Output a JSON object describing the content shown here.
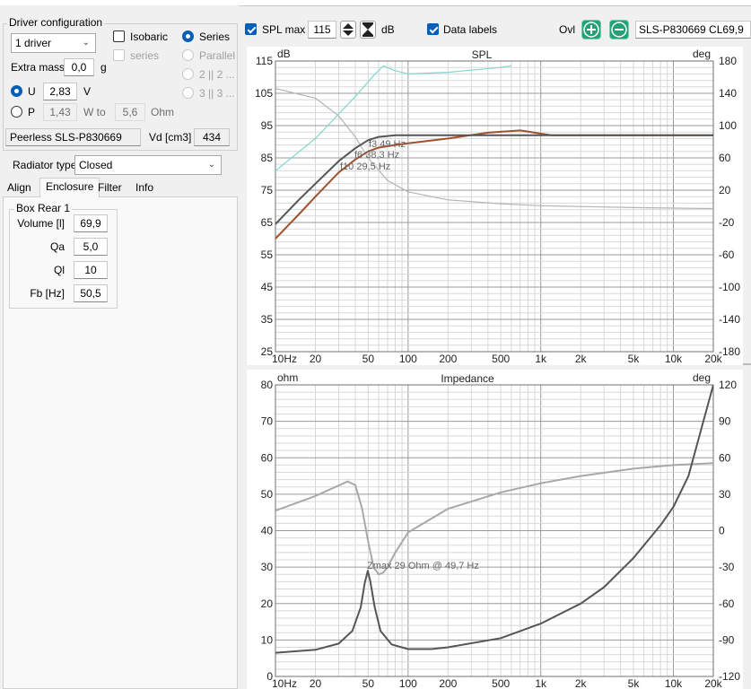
{
  "driver_config": {
    "title": "Driver configuration",
    "drivers_value": "1 driver",
    "isobaric_label": "Isobaric",
    "isobaric_sub": "series",
    "series_label": "Series",
    "parallel_label": "Parallel",
    "opt2_label": "2 || 2 ...",
    "opt3_label": "3 || 3 ...",
    "extra_mass_label": "Extra mass",
    "extra_mass_value": "0,0",
    "extra_mass_unit": "g",
    "u_label": "U",
    "u_value": "2,83",
    "u_unit": "V",
    "p_label": "P",
    "p_value": "1,43",
    "p_unit": "W to",
    "ohm_value": "5,6",
    "ohm_unit": "Ohm",
    "driver_name": "Peerless SLS-P830669",
    "vd_label": "Vd [cm3]",
    "vd_value": "434"
  },
  "radiator": {
    "label": "Radiator type",
    "value": "Closed"
  },
  "tabs": [
    "Align",
    "Enclosure",
    "Filter",
    "Info"
  ],
  "enclosure": {
    "group_title": "Box Rear 1",
    "fields": [
      {
        "label": "Volume [l]",
        "value": "69,9"
      },
      {
        "label": "Qa",
        "value": "5,0"
      },
      {
        "label": "Ql",
        "value": "10"
      },
      {
        "label": "Fb [Hz]",
        "value": "50,5"
      }
    ]
  },
  "toolbar": {
    "spl_max_label": "SPL max",
    "spl_max_value": "115",
    "db_unit": "dB",
    "data_labels_label": "Data labels",
    "ovl_label": "Ovl",
    "preset_value": "SLS-P830669 CL69,9"
  },
  "colors": {
    "accent": "#005fb8",
    "green_button": "#24a275",
    "spl_curve": "#a0522d",
    "total_curve": "#555555",
    "phase_curve": "#b4b4b4",
    "excursion_curve": "#7fd8d0"
  },
  "chart_data": [
    {
      "type": "line",
      "title": "SPL",
      "left_unit": "dB",
      "right_unit": "deg",
      "x_scale": "log",
      "xlim": [
        10,
        20000
      ],
      "ylim": [
        25,
        115
      ],
      "y2lim": [
        -180,
        180
      ],
      "x_ticks": [
        "10Hz",
        "20",
        "50",
        "100",
        "200",
        "500",
        "1k",
        "2k",
        "5k",
        "10k",
        "20k"
      ],
      "y_ticks": [
        "115",
        "105",
        "95",
        "85",
        "75",
        "65",
        "55",
        "45",
        "35",
        "25"
      ],
      "y2_ticks": [
        "180",
        "140",
        "100",
        "60",
        "20",
        "-20",
        "-60",
        "-100",
        "-140",
        "-180"
      ],
      "annotations": [
        "f3 49 Hz",
        "f6 38,3 Hz",
        "f10 29,5 Hz"
      ],
      "grid": true,
      "series": [
        {
          "role": "total",
          "x": [
            10,
            15,
            20,
            30,
            40,
            50,
            60,
            80,
            100,
            200,
            500,
            1000,
            2000,
            5000,
            10000,
            20000
          ],
          "y": [
            64.5,
            72,
            77,
            84,
            88,
            90.5,
            91.5,
            92,
            92,
            92,
            92,
            92,
            92,
            92,
            92,
            92
          ]
        },
        {
          "role": "driver",
          "x": [
            10,
            15,
            20,
            30,
            40,
            50,
            60,
            80,
            100,
            200,
            400,
            700,
            900,
            1200,
            2000,
            5000,
            10000,
            20000
          ],
          "y": [
            60,
            67.5,
            73,
            80.5,
            84.5,
            87,
            88.2,
            89,
            89.5,
            91,
            92.8,
            93.5,
            92.8,
            92,
            92,
            92,
            92,
            92
          ]
        },
        {
          "role": "phase",
          "x": [
            10,
            20,
            30,
            40,
            50,
            70,
            100,
            200,
            500,
            1000,
            5000,
            20000
          ],
          "y": [
            106.5,
            103.5,
            98,
            91.5,
            85,
            78,
            74.5,
            72,
            70.8,
            70.2,
            69.6,
            69.3
          ]
        },
        {
          "role": "excursion",
          "x": [
            10,
            20,
            40,
            55,
            65,
            80,
            100,
            200,
            500,
            600
          ],
          "y": [
            81,
            91,
            104,
            110.5,
            113.5,
            112,
            111,
            111.5,
            113,
            113.5
          ]
        }
      ]
    },
    {
      "type": "line",
      "title": "Impedance",
      "left_unit": "ohm",
      "right_unit": "deg",
      "x_scale": "log",
      "xlim": [
        10,
        20000
      ],
      "ylim": [
        0,
        80
      ],
      "y2lim": [
        -120,
        120
      ],
      "x_ticks": [
        "10Hz",
        "20",
        "50",
        "100",
        "200",
        "500",
        "1k",
        "2k",
        "5k",
        "10k",
        "20k"
      ],
      "y_ticks": [
        "80",
        "70",
        "60",
        "50",
        "40",
        "30",
        "20",
        "10",
        "0"
      ],
      "y2_ticks": [
        "120",
        "90",
        "60",
        "30",
        "0",
        "-30",
        "-60",
        "-90",
        "-120"
      ],
      "annotations": [
        "Zmax 29 Ohm @ 49,7 Hz"
      ],
      "grid": true,
      "series": [
        {
          "role": "impedance",
          "x": [
            10,
            20,
            30,
            38,
            44,
            47,
            49.7,
            52,
            56,
            62,
            75,
            100,
            150,
            200,
            500,
            1000,
            2000,
            3000,
            5000,
            8000,
            10000,
            13000,
            20000
          ],
          "y": [
            6.5,
            7.3,
            9,
            12.5,
            19,
            25.5,
            29,
            26,
            19,
            12.5,
            8.8,
            7.5,
            7.5,
            8,
            10.5,
            14.5,
            20,
            24.5,
            32.5,
            41.5,
            46.5,
            55,
            80
          ]
        },
        {
          "role": "phase",
          "x": [
            10,
            20,
            35,
            40,
            45,
            50,
            55,
            60,
            65,
            70,
            80,
            100,
            200,
            500,
            1000,
            2000,
            5000,
            10000,
            20000
          ],
          "y": [
            45.5,
            49.5,
            53.5,
            52.5,
            46,
            37,
            30,
            28,
            28.5,
            30,
            34,
            39.5,
            46,
            50.5,
            53,
            55,
            57,
            58,
            58.5
          ]
        }
      ]
    }
  ]
}
